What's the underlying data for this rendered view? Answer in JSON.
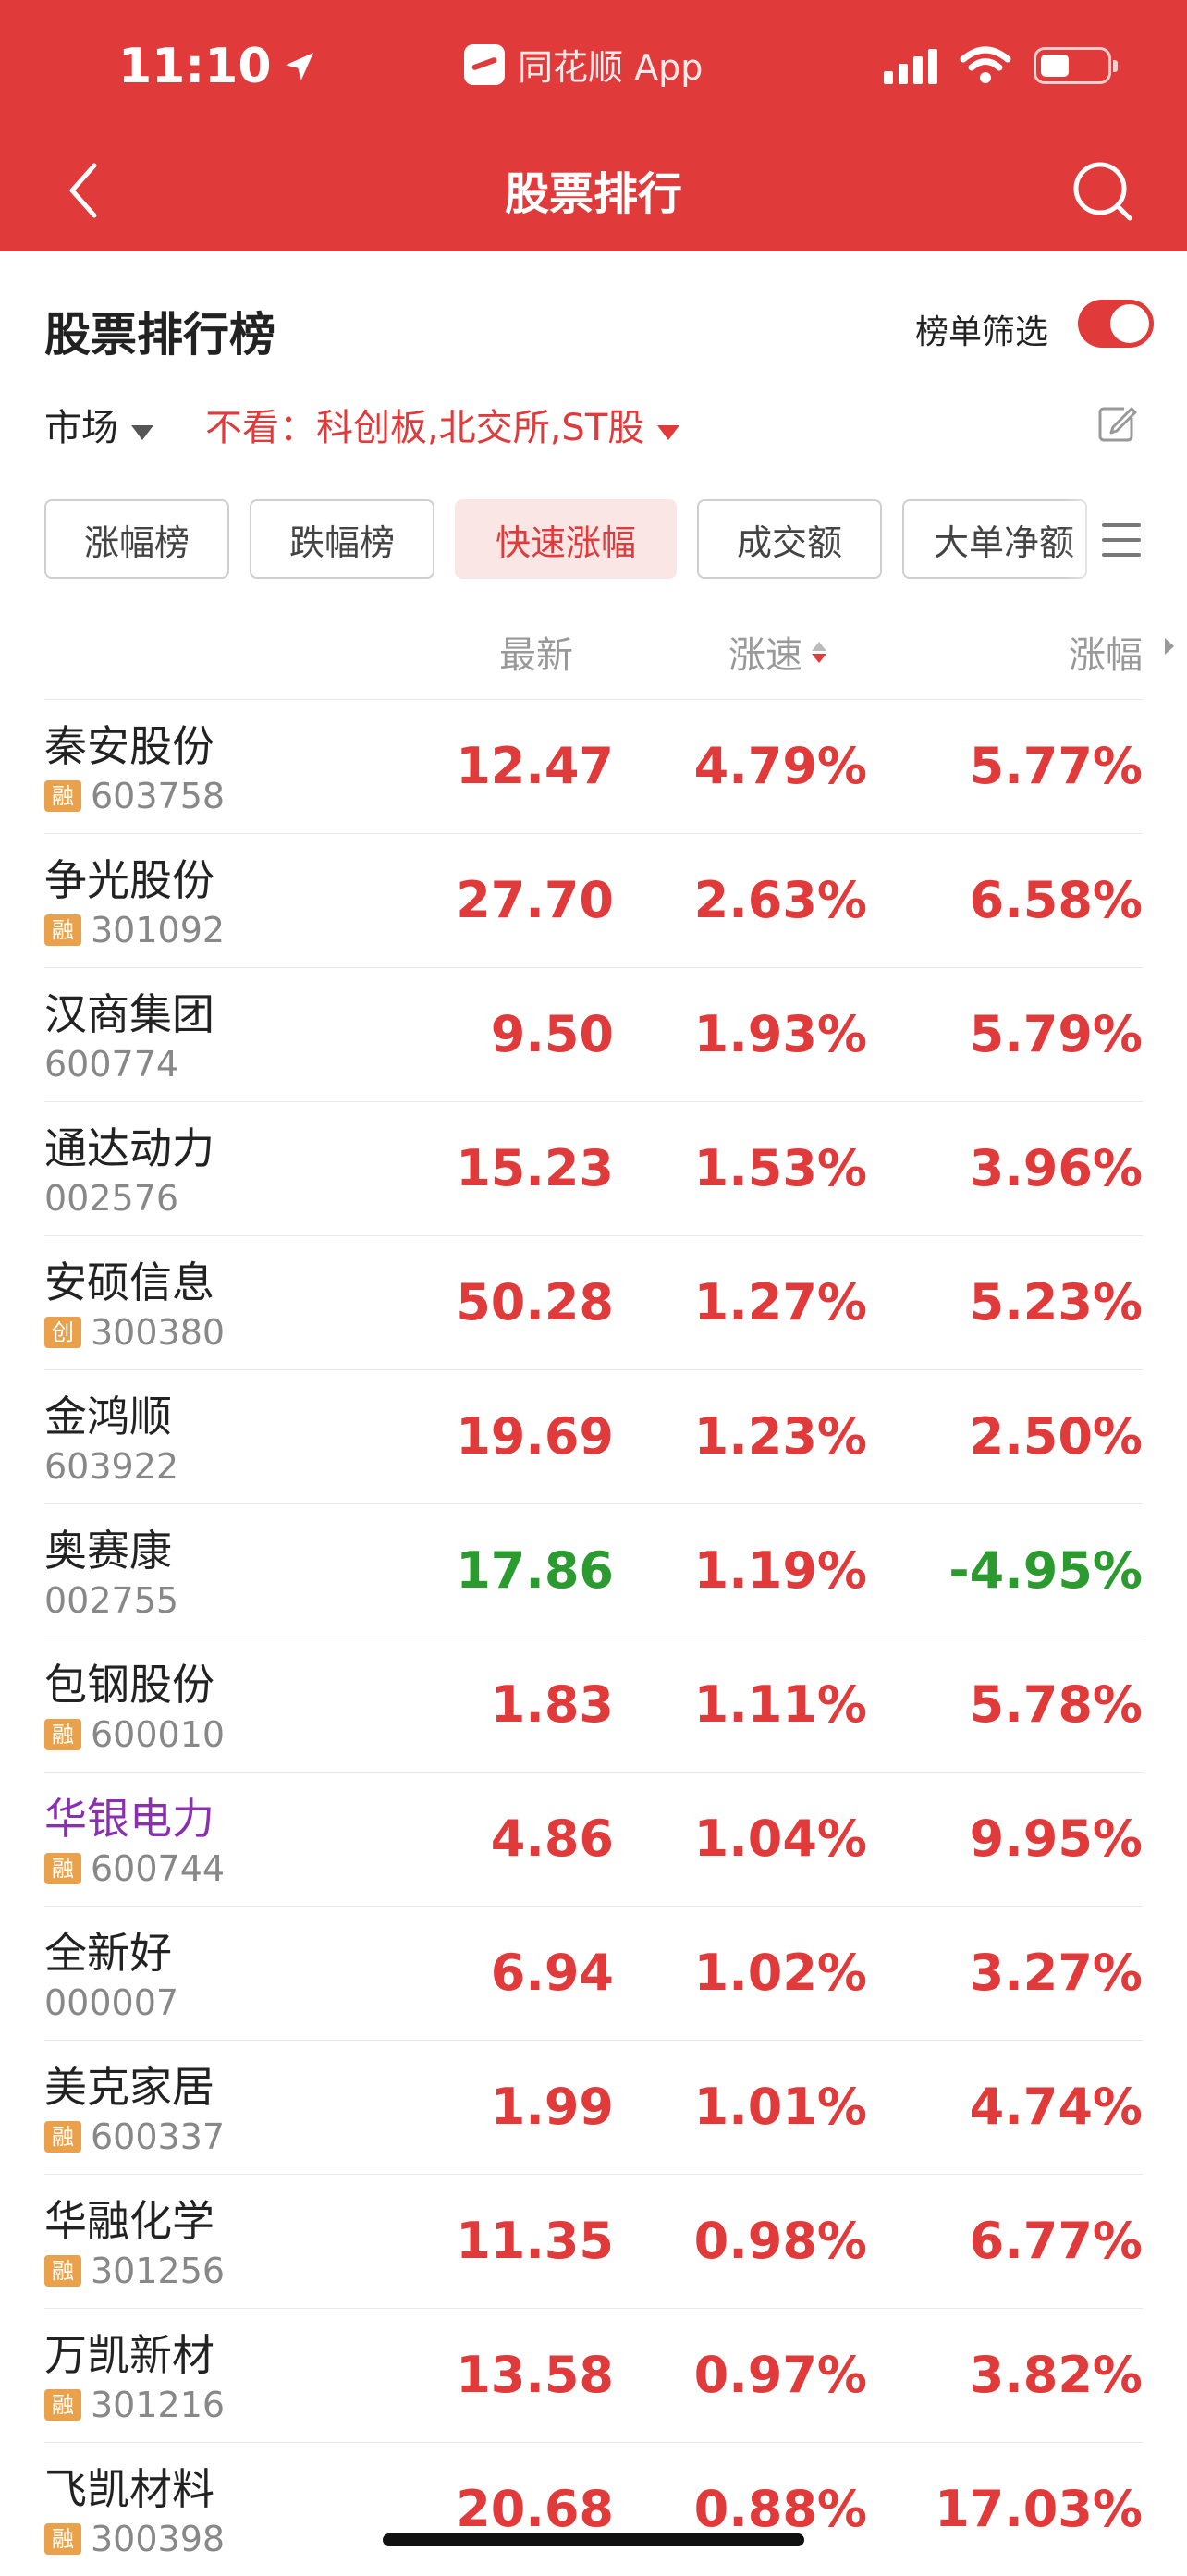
{
  "status_bar": {
    "time": "11:10",
    "app_name": "同花顺 App"
  },
  "nav": {
    "title": "股票排行"
  },
  "section": {
    "title": "股票排行榜",
    "filter_label": "榜单筛选",
    "filter_on": true
  },
  "market": {
    "label": "市场",
    "exclude": "不看：科创板,北交所,ST股"
  },
  "tabs": [
    "涨幅榜",
    "跌幅榜",
    "快速涨幅",
    "成交额",
    "大单净额"
  ],
  "active_tab": 2,
  "columns": {
    "latest": "最新",
    "speed": "涨速",
    "change": "涨幅"
  },
  "rows": [
    {
      "name": "秦安股份",
      "code": "603758",
      "badge": "融",
      "latest": "12.47",
      "speed": "4.79%",
      "change": "5.77%",
      "color": "red"
    },
    {
      "name": "争光股份",
      "code": "301092",
      "badge": "融",
      "latest": "27.70",
      "speed": "2.63%",
      "change": "6.58%",
      "color": "red"
    },
    {
      "name": "汉商集团",
      "code": "600774",
      "badge": "",
      "latest": "9.50",
      "speed": "1.93%",
      "change": "5.79%",
      "color": "red"
    },
    {
      "name": "通达动力",
      "code": "002576",
      "badge": "",
      "latest": "15.23",
      "speed": "1.53%",
      "change": "3.96%",
      "color": "red"
    },
    {
      "name": "安硕信息",
      "code": "300380",
      "badge": "创",
      "latest": "50.28",
      "speed": "1.27%",
      "change": "5.23%",
      "color": "red"
    },
    {
      "name": "金鸿顺",
      "code": "603922",
      "badge": "",
      "latest": "19.69",
      "speed": "1.23%",
      "change": "2.50%",
      "color": "red"
    },
    {
      "name": "奥赛康",
      "code": "002755",
      "badge": "",
      "latest": "17.86",
      "speed": "1.19%",
      "change": "-4.95%",
      "color": "green"
    },
    {
      "name": "包钢股份",
      "code": "600010",
      "badge": "融",
      "latest": "1.83",
      "speed": "1.11%",
      "change": "5.78%",
      "color": "red"
    },
    {
      "name": "华银电力",
      "code": "600744",
      "badge": "融",
      "latest": "4.86",
      "speed": "1.04%",
      "change": "9.95%",
      "color": "red",
      "highlight": true
    },
    {
      "name": "全新好",
      "code": "000007",
      "badge": "",
      "latest": "6.94",
      "speed": "1.02%",
      "change": "3.27%",
      "color": "red"
    },
    {
      "name": "美克家居",
      "code": "600337",
      "badge": "融",
      "latest": "1.99",
      "speed": "1.01%",
      "change": "4.74%",
      "color": "red"
    },
    {
      "name": "华融化学",
      "code": "301256",
      "badge": "融",
      "latest": "11.35",
      "speed": "0.98%",
      "change": "6.77%",
      "color": "red"
    },
    {
      "name": "万凯新材",
      "code": "301216",
      "badge": "融",
      "latest": "13.58",
      "speed": "0.97%",
      "change": "3.82%",
      "color": "red"
    },
    {
      "name": "飞凯材料",
      "code": "300398",
      "badge": "融",
      "latest": "20.68",
      "speed": "0.88%",
      "change": "17.03%",
      "color": "red"
    }
  ],
  "colors": {
    "brand_red": "#e03a3b",
    "down_green": "#2b9a2f",
    "highlight_purple": "#8a2fb0",
    "badge_orange": "#e9a24b"
  }
}
